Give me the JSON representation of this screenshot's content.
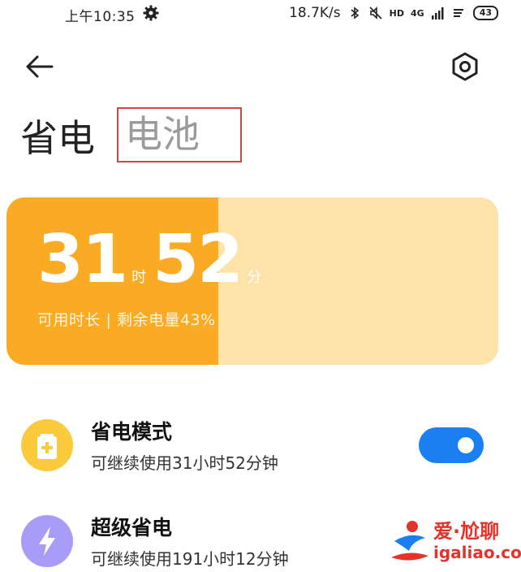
{
  "status_bar": {
    "time": "上午10:35",
    "speed": "18.7K/s",
    "hd": "HD",
    "network": "4G",
    "battery": "43"
  },
  "tabs": {
    "power_saving": "省电",
    "battery": "电池"
  },
  "battery_card": {
    "hours": "31",
    "hours_unit": "时",
    "minutes": "52",
    "minutes_unit": "分",
    "caption": "可用时长 | 剩余电量43%",
    "level_fraction": 0.43,
    "fill_color": "#fbaa24",
    "track_color": "#fde3a8"
  },
  "power_mode": {
    "title": "省电模式",
    "subtitle": "可继续使用31小时52分钟",
    "enabled": true,
    "icon": "battery-plus-icon",
    "icon_color": "#fbc93c"
  },
  "ultra_mode": {
    "title": "超级省电",
    "subtitle": "可继续使用191小时12分钟",
    "icon": "lightning-icon",
    "icon_color": "#a89cf7"
  },
  "toggle_color": "#1a7ff0",
  "watermark": {
    "title": "爱·尬聊",
    "url": "igaliao.com"
  }
}
